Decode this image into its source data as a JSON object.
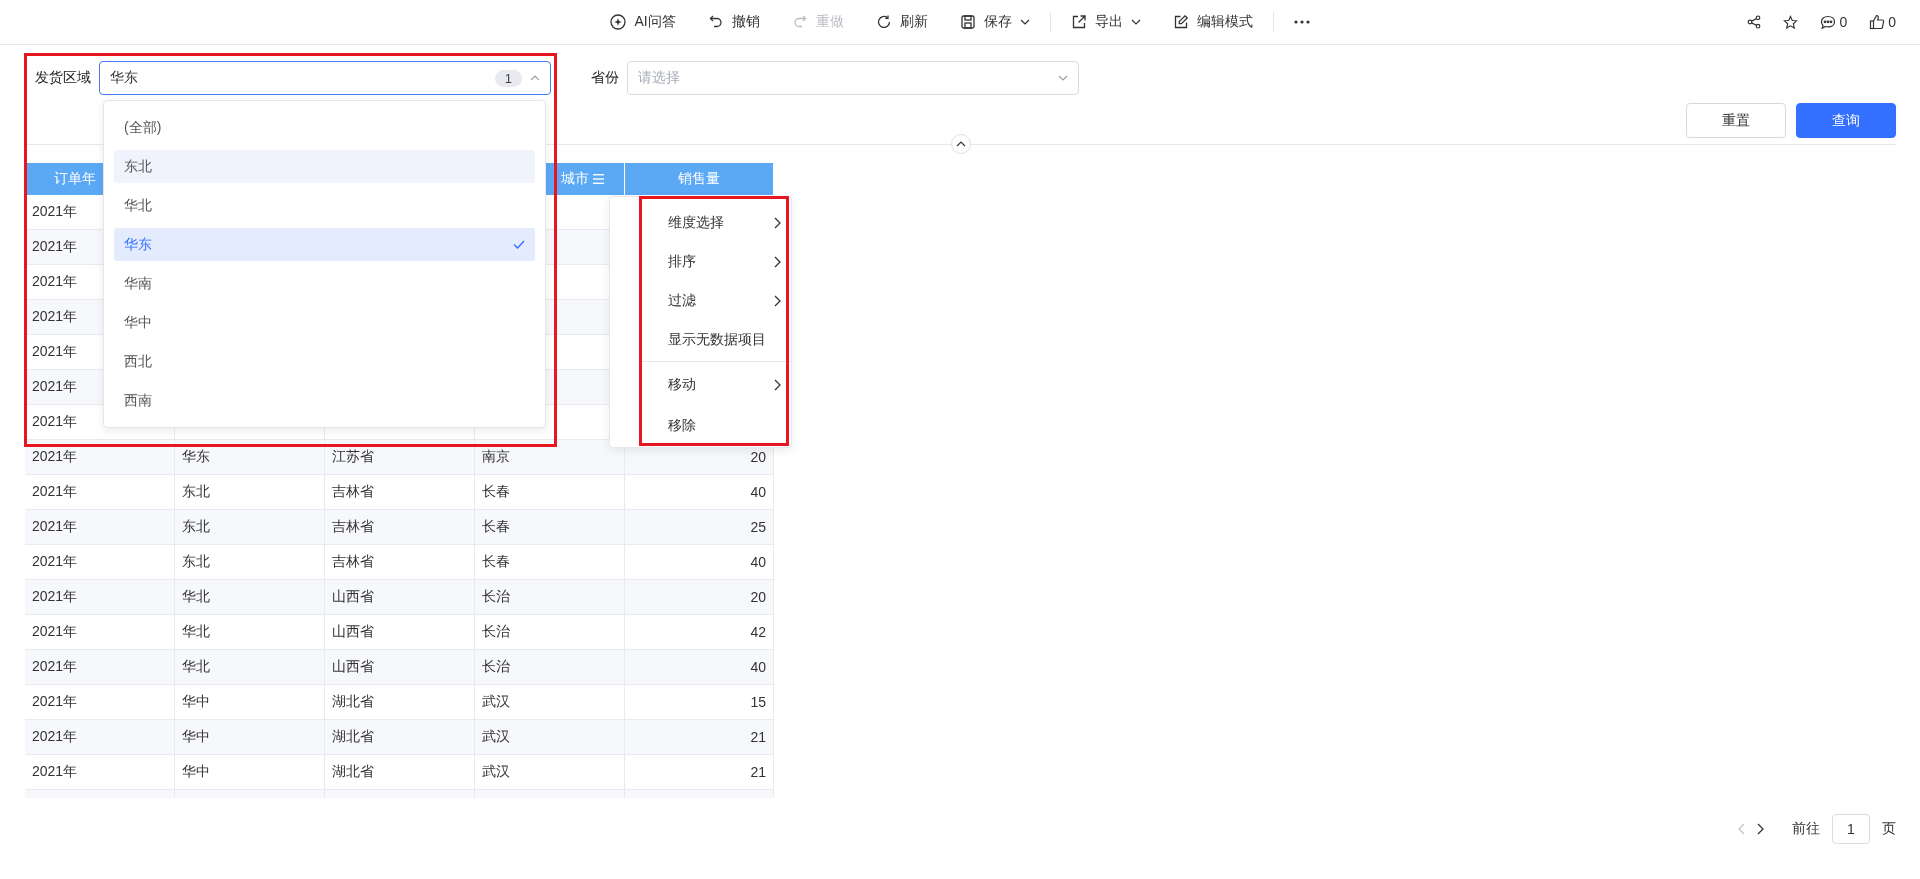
{
  "toolbar": {
    "items": [
      {
        "kind": "ai",
        "label": "AI问答",
        "disabled": false,
        "caret": false
      },
      {
        "kind": "undo",
        "label": "撤销",
        "disabled": false,
        "caret": false
      },
      {
        "kind": "redo",
        "label": "重做",
        "disabled": true,
        "caret": false
      },
      {
        "kind": "refresh",
        "label": "刷新",
        "disabled": false,
        "caret": false
      },
      {
        "kind": "save",
        "label": "保存",
        "disabled": false,
        "caret": true
      },
      {
        "kind": "separator"
      },
      {
        "kind": "export",
        "label": "导出",
        "disabled": false,
        "caret": true
      },
      {
        "kind": "edit",
        "label": "编辑模式",
        "disabled": false,
        "caret": false
      },
      {
        "kind": "separator"
      },
      {
        "kind": "more"
      }
    ],
    "right": [
      {
        "kind": "share"
      },
      {
        "kind": "star"
      },
      {
        "kind": "comment",
        "count": "0"
      },
      {
        "kind": "like",
        "count": "0"
      }
    ]
  },
  "filters": [
    {
      "label": "发货区域",
      "value": "华东",
      "count": "1",
      "expanded": true
    },
    {
      "label": "省份",
      "placeholder": "请选择",
      "expanded": false
    }
  ],
  "buttons": [
    {
      "label": "重置",
      "kind": "default"
    },
    {
      "label": "查询",
      "kind": "primary"
    }
  ],
  "dropdown": {
    "options": [
      {
        "label": "(全部)",
        "selected": false,
        "highlighted": false
      },
      {
        "label": "东北",
        "selected": false,
        "highlighted": true
      },
      {
        "label": "华北",
        "selected": false,
        "highlighted": false
      },
      {
        "label": "华东",
        "selected": true,
        "highlighted": false
      },
      {
        "label": "华南",
        "selected": false,
        "highlighted": false
      },
      {
        "label": "华中",
        "selected": false,
        "highlighted": false
      },
      {
        "label": "西北",
        "selected": false,
        "highlighted": false
      },
      {
        "label": "西南",
        "selected": false,
        "highlighted": false
      }
    ]
  },
  "table": {
    "header": {
      "column_1": {
        "label": "订单年",
        "menu_icon": false
      },
      "column_4": {
        "label": "城市",
        "menu_icon": true
      },
      "column_5": {
        "label": "销售量",
        "menu_icon": false
      }
    },
    "rows": [
      {
        "cells": [
          "2021年"
        ]
      },
      {
        "cells": [
          "2021年"
        ]
      },
      {
        "cells": [
          "2021年"
        ]
      },
      {
        "cells": [
          "2021年"
        ]
      },
      {
        "cells": [
          "2021年"
        ]
      },
      {
        "cells": [
          "2021年"
        ]
      },
      {
        "cells": [
          "2021年"
        ]
      },
      {
        "cells": [
          "2021年",
          "华东",
          "江苏省",
          "南京",
          "20"
        ]
      },
      {
        "cells": [
          "2021年",
          "东北",
          "吉林省",
          "长春",
          "40"
        ]
      },
      {
        "cells": [
          "2021年",
          "东北",
          "吉林省",
          "长春",
          "25"
        ]
      },
      {
        "cells": [
          "2021年",
          "东北",
          "吉林省",
          "长春",
          "40"
        ]
      },
      {
        "cells": [
          "2021年",
          "华北",
          "山西省",
          "长治",
          "20"
        ]
      },
      {
        "cells": [
          "2021年",
          "华北",
          "山西省",
          "长治",
          "42"
        ]
      },
      {
        "cells": [
          "2021年",
          "华北",
          "山西省",
          "长治",
          "40"
        ]
      },
      {
        "cells": [
          "2021年",
          "华中",
          "湖北省",
          "武汉",
          "15"
        ]
      },
      {
        "cells": [
          "2021年",
          "华中",
          "湖北省",
          "武汉",
          "21"
        ]
      },
      {
        "cells": [
          "2021年",
          "华中",
          "湖北省",
          "武汉",
          "21"
        ]
      }
    ]
  },
  "context_menu": {
    "items": [
      {
        "label": "维度选择",
        "submenu": true,
        "divider_before": false
      },
      {
        "label": "排序",
        "submenu": true,
        "divider_before": false
      },
      {
        "label": "过滤",
        "submenu": true,
        "divider_before": false
      },
      {
        "label": "显示无数据项目",
        "submenu": false,
        "divider_before": false
      },
      {
        "label": "移动",
        "submenu": true,
        "divider_before": true
      },
      {
        "label": "移除",
        "submenu": false,
        "divider_before": false
      }
    ]
  },
  "pager": {
    "prev_disabled": true,
    "next_disabled": false,
    "goto_label": "前往",
    "page": "1",
    "unit": "页"
  },
  "highlights": [
    {
      "color": "#e8171f"
    },
    {
      "color": "#e8171f"
    }
  ]
}
